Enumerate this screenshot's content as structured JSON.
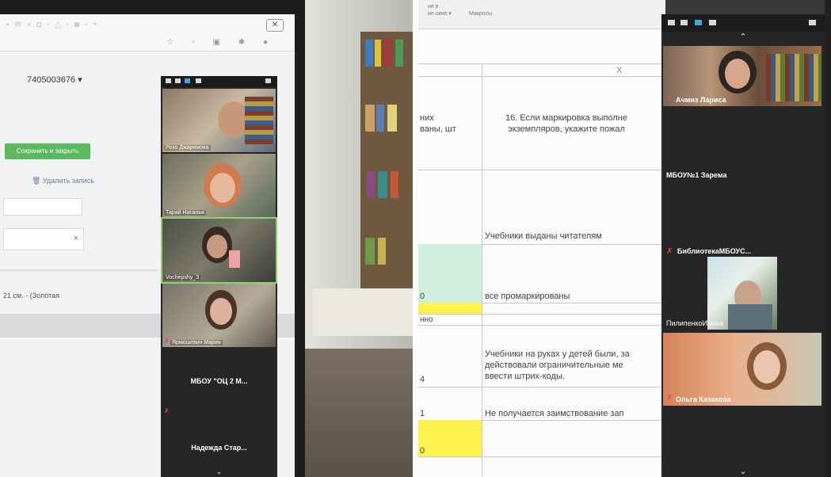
{
  "left_photo": {
    "account_id": "7405003676 ▾",
    "save_button": "Сохранить и закрыть",
    "delete_link": "🗑 Удалить запись",
    "field_clear": "×",
    "size_text": "21 см. - (Золотая",
    "zoom": {
      "participants": [
        {
          "name": "Роза Джаримова",
          "muted": false
        },
        {
          "name": "Тарай Наталья",
          "muted": false
        },
        {
          "name": "Vochepshy_З",
          "muted": false
        },
        {
          "name": "Ярмошевич Мария",
          "muted": true
        }
      ],
      "text_tiles": [
        {
          "name": "МБОУ \"ОЦ 2 М...",
          "muted": true
        },
        {
          "name": "Надежда Стар...",
          "muted": false
        }
      ]
    }
  },
  "right_photo": {
    "ribbon": {
      "group_a": "ие в\nие окно ▾",
      "group_b": "Макросы"
    },
    "sheet": {
      "header_x": "X",
      "question": "16. Если маркировка выполне\nэкземпляров, укажите пожал",
      "left_clip": "них\nваны, шт",
      "rows": [
        {
          "value": "",
          "text": "Учебники выданы читателям"
        },
        {
          "value": "0",
          "text": "все промаркированы"
        },
        {
          "value": "нно",
          "text": ""
        },
        {
          "value": "4",
          "text": "Учебники на руках у детей были, за\nдействовали ограничительные ме\nввести штрих-коды."
        },
        {
          "value": "1",
          "text": "Не получается заимствование зап"
        },
        {
          "value": "0",
          "text": ""
        }
      ]
    },
    "zoom": {
      "participants": [
        {
          "name": "Ачмиз Лариса",
          "muted": true
        },
        {
          "name": "МБОУ№1 Зарема",
          "muted": false
        },
        {
          "name": "БиблиотекаМБОУС...",
          "muted": true
        },
        {
          "name": "ПилипенкоИрина",
          "muted": false
        },
        {
          "name": "Ольга Казакова",
          "muted": true
        }
      ]
    }
  },
  "colors": {
    "save_green": "#5cb85c",
    "zoom_dark": "#262626",
    "muted_red": "#e14b4b",
    "cell_green": "#cfeedd",
    "cell_yellow": "#fff24d"
  }
}
